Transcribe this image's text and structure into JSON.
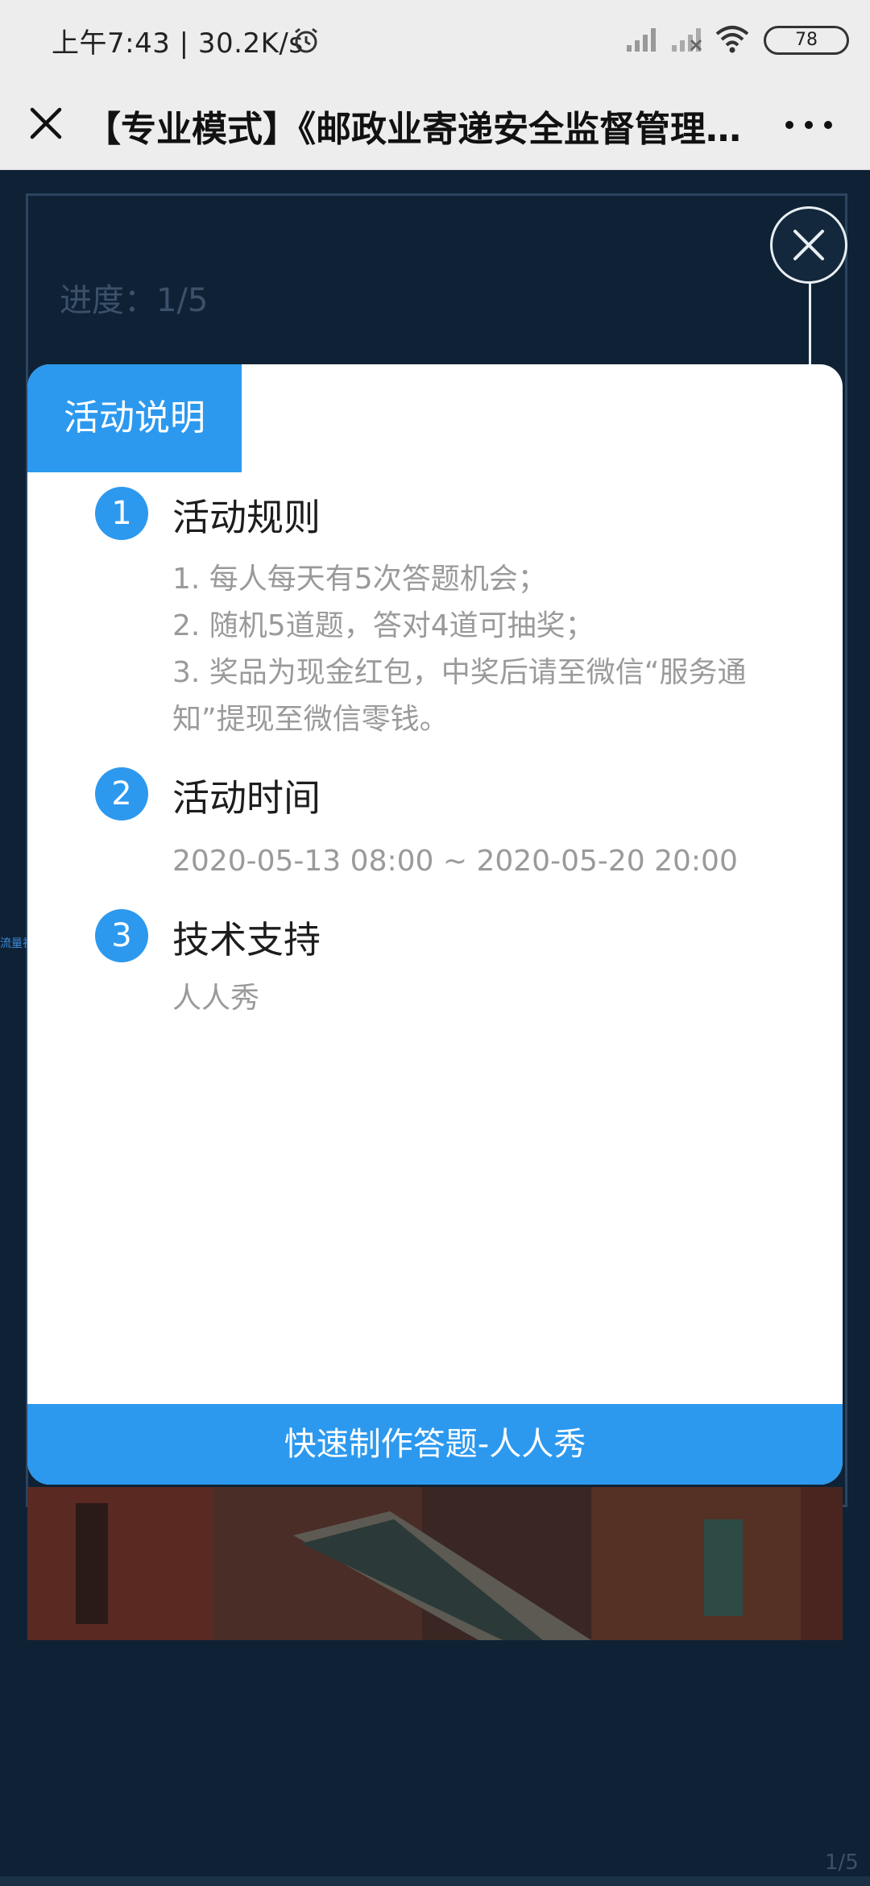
{
  "status_bar": {
    "time": "上午7:43 | 30.2K/s",
    "battery": "78"
  },
  "title_bar": {
    "title": "【专业模式】《邮政业寄递安全监督管理…"
  },
  "background": {
    "progress": "进度：1/5",
    "side_link": "流量社区",
    "page_indicator": "1/5"
  },
  "modal": {
    "tab_label": "活动说明",
    "sections": [
      {
        "number": "1",
        "title": "活动规则",
        "lines": [
          "1. 每人每天有5次答题机会；",
          "2. 随机5道题，答对4道可抽奖；",
          "3. 奖品为现金红包，中奖后请至微信“服务通知”提现至微信零钱。"
        ]
      },
      {
        "number": "2",
        "title": "活动时间",
        "text": "2020-05-13 08:00 ~ 2020-05-20 20:00"
      },
      {
        "number": "3",
        "title": "技术支持",
        "text": "人人秀"
      }
    ],
    "footer_label": "快速制作答题-人人秀"
  }
}
